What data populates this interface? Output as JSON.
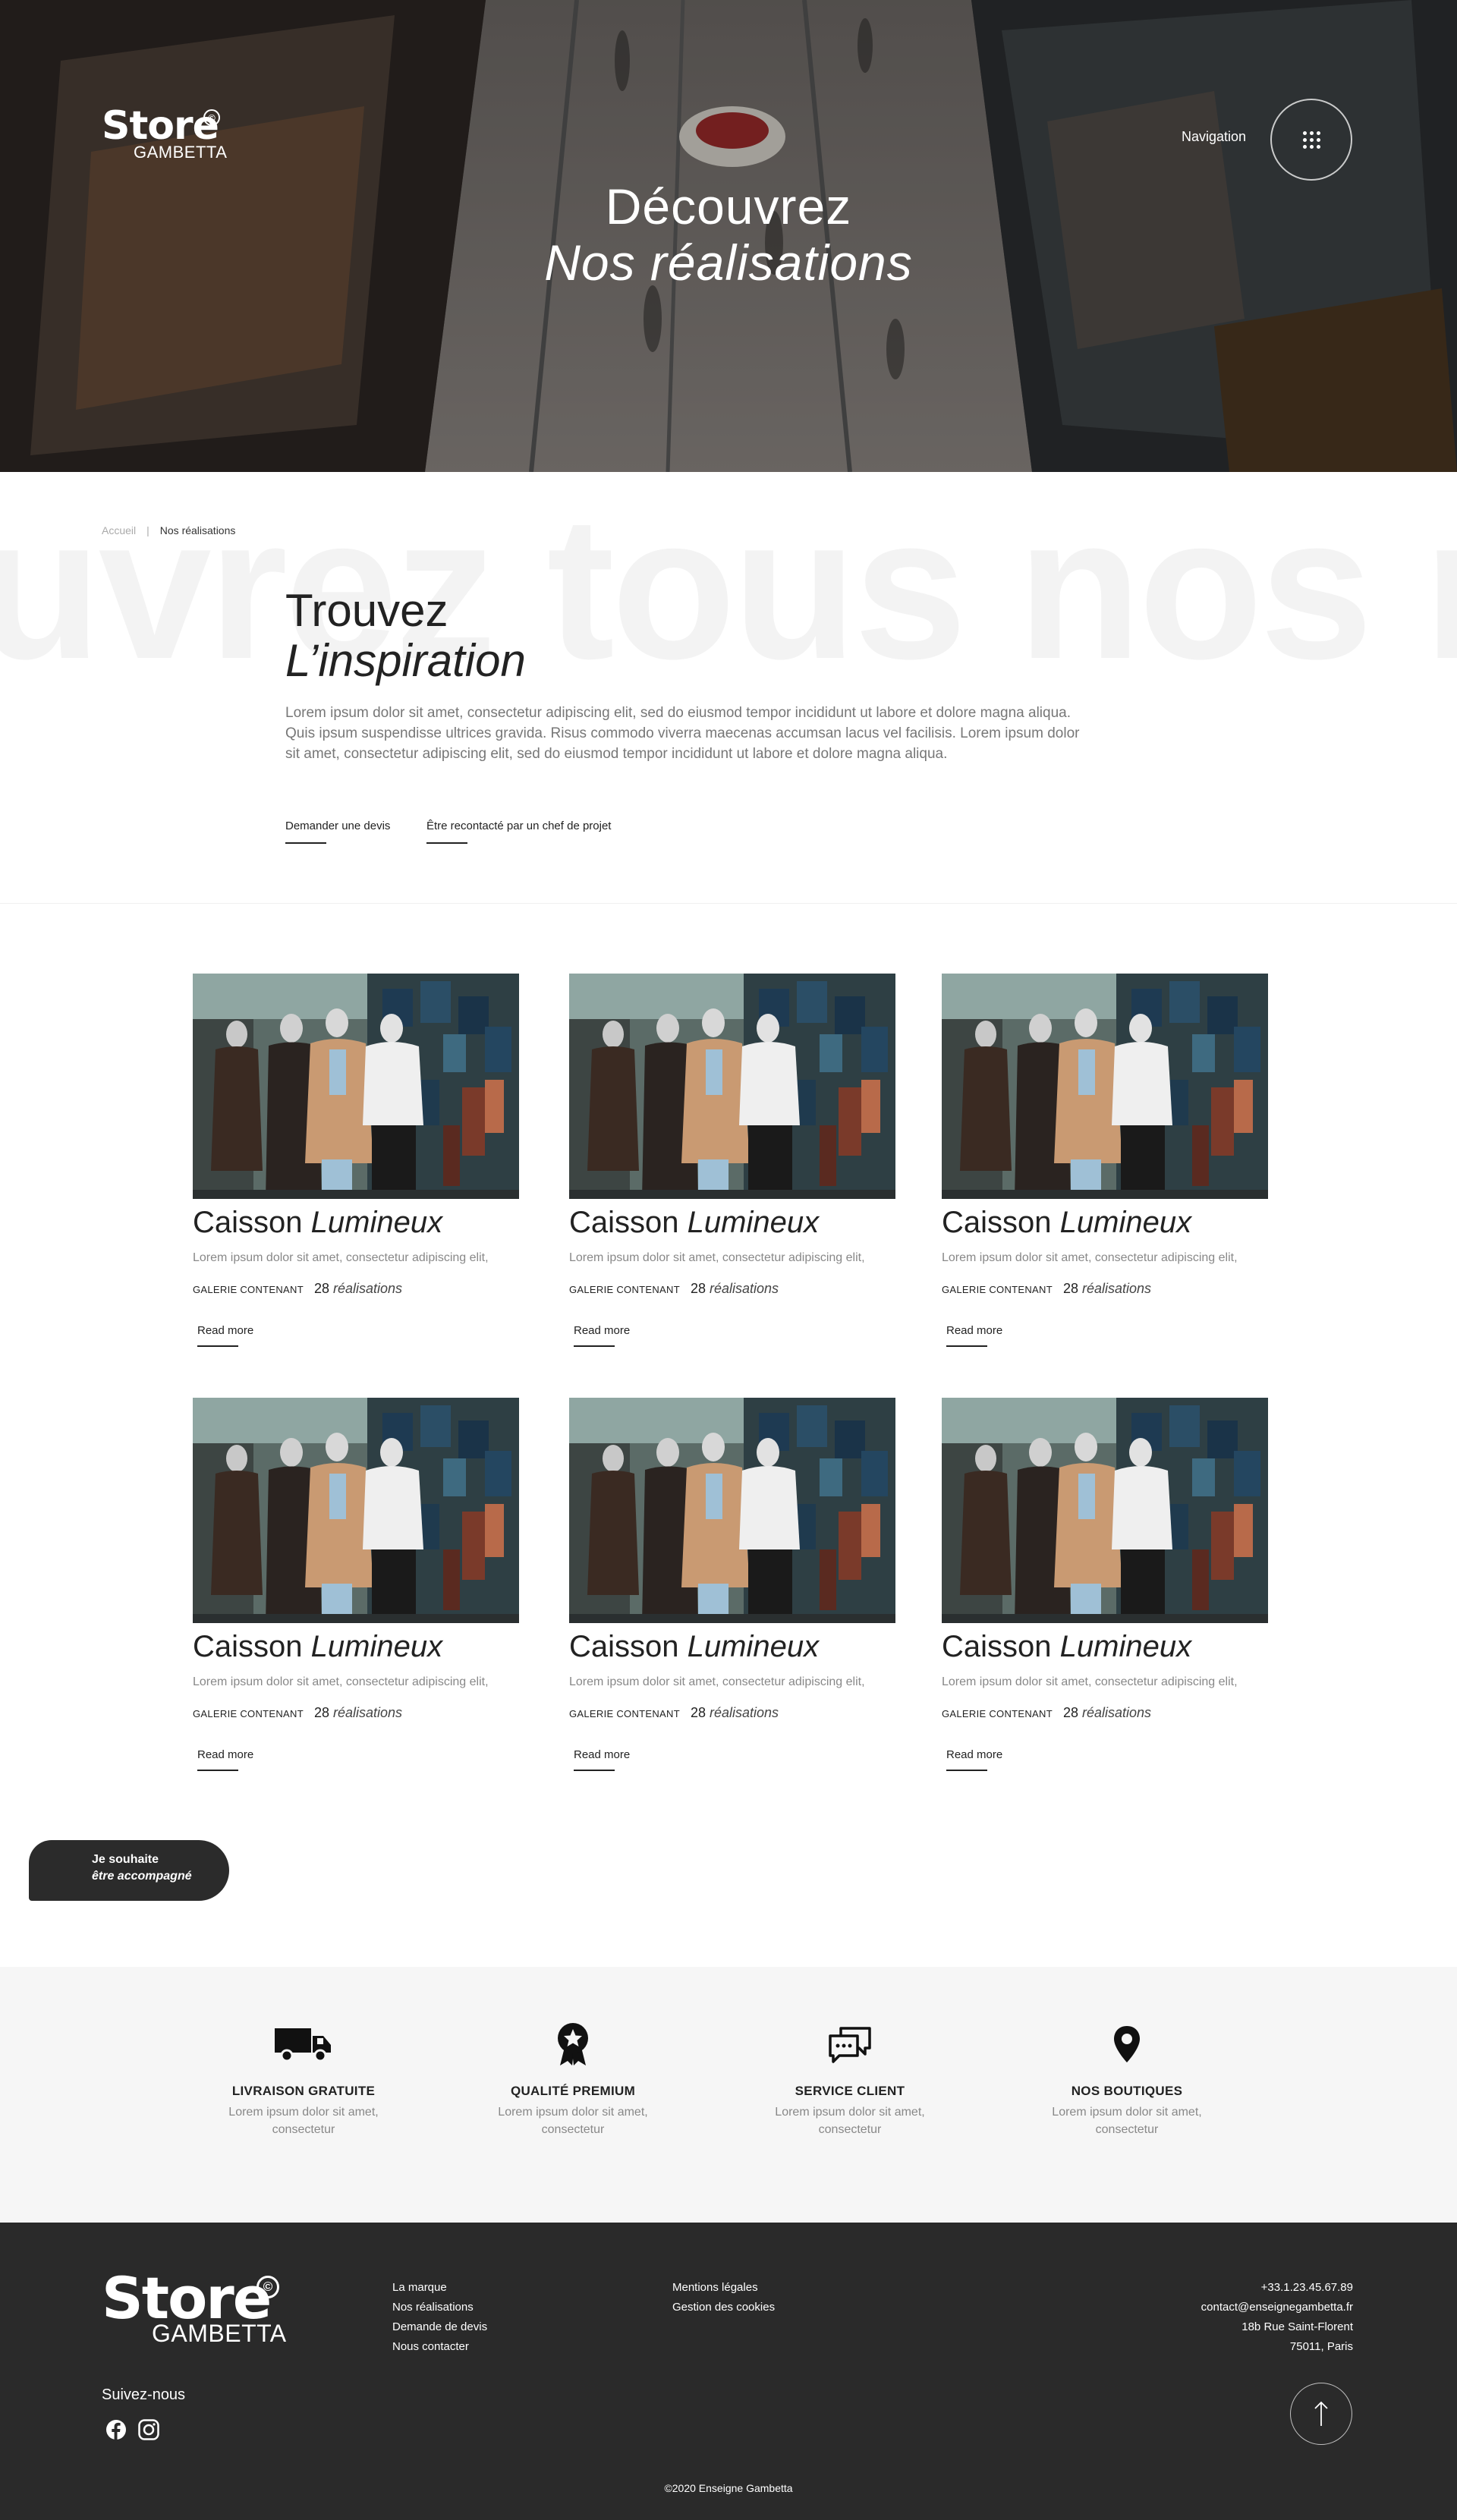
{
  "brand": {
    "name": "Store",
    "sub": "GAMBETTA",
    "copyright_mark": "©"
  },
  "header": {
    "nav_label": "Navigation"
  },
  "hero": {
    "title": "Découvrez",
    "subtitle": "Nos réalisations"
  },
  "breadcrumb": {
    "home": "Accueil",
    "separator": "|",
    "current": "Nos réalisations"
  },
  "intro": {
    "background_text": "uvrez tous nos mé",
    "title": "Trouvez",
    "subtitle": "L’inspiration",
    "paragraph": "Lorem ipsum dolor sit amet, consectetur adipiscing elit, sed do eiusmod tempor incididunt ut labore et dolore magna aliqua. Quis ipsum suspendisse ultrices gravida. Risus commodo viverra maecenas accumsan lacus vel facilisis. Lorem ipsum dolor sit amet, consectetur adipiscing elit, sed do eiusmod tempor incididunt ut labore et dolore magna aliqua.",
    "cta_quote": "Demander une devis",
    "cta_contact": "Être recontacté par un chef de projet"
  },
  "cards": [
    {
      "title": "Caisson",
      "title_italic": "Lumineux",
      "desc": "Lorem ipsum dolor sit amet, consectetur adipiscing elit,",
      "gallery_label": "GALERIE CONTENANT",
      "count": "28",
      "count_label": "réalisations",
      "read_more": "Read more"
    },
    {
      "title": "Caisson",
      "title_italic": "Lumineux",
      "desc": "Lorem ipsum dolor sit amet, consectetur adipiscing elit,",
      "gallery_label": "GALERIE CONTENANT",
      "count": "28",
      "count_label": "réalisations",
      "read_more": "Read more"
    },
    {
      "title": "Caisson",
      "title_italic": "Lumineux",
      "desc": "Lorem ipsum dolor sit amet, consectetur adipiscing elit,",
      "gallery_label": "GALERIE CONTENANT",
      "count": "28",
      "count_label": "réalisations",
      "read_more": "Read more"
    },
    {
      "title": "Caisson",
      "title_italic": "Lumineux",
      "desc": "Lorem ipsum dolor sit amet, consectetur adipiscing elit,",
      "gallery_label": "GALERIE CONTENANT",
      "count": "28",
      "count_label": "réalisations",
      "read_more": "Read more"
    },
    {
      "title": "Caisson",
      "title_italic": "Lumineux",
      "desc": "Lorem ipsum dolor sit amet, consectetur adipiscing elit,",
      "gallery_label": "GALERIE CONTENANT",
      "count": "28",
      "count_label": "réalisations",
      "read_more": "Read more"
    },
    {
      "title": "Caisson",
      "title_italic": "Lumineux",
      "desc": "Lorem ipsum dolor sit amet, consectetur adipiscing elit,",
      "gallery_label": "GALERIE CONTENANT",
      "count": "28",
      "count_label": "réalisations",
      "read_more": "Read more"
    }
  ],
  "chat_bubble": {
    "line1": "Je souhaite",
    "line2": "être accompagné"
  },
  "features": [
    {
      "icon": "truck-icon",
      "title": "LIVRAISON GRATUITE",
      "desc": "Lorem ipsum dolor sit amet, consectetur"
    },
    {
      "icon": "award-icon",
      "title": "QUALITÉ PREMIUM",
      "desc": "Lorem ipsum dolor sit amet, consectetur"
    },
    {
      "icon": "chat-icon",
      "title": "SERVICE CLIENT",
      "desc": "Lorem ipsum dolor sit amet, consectetur"
    },
    {
      "icon": "map-pin-icon",
      "title": "NOS BOUTIQUES",
      "desc": "Lorem ipsum dolor sit amet, consectetur"
    }
  ],
  "footer": {
    "follow": "Suivez-nous",
    "links_col1": [
      "La marque",
      "Nos réalisations",
      "Demande de devis",
      "Nous contacter"
    ],
    "links_col2": [
      "Mentions légales",
      "Gestion des cookies"
    ],
    "contact": {
      "phone": "+33.1.23.45.67.89",
      "email": "contact@enseignegambetta.fr",
      "address1": "18b Rue Saint-Florent",
      "address2": "75011, Paris"
    },
    "copyright": "©2020 Enseigne Gambetta",
    "social": [
      "facebook-icon",
      "instagram-icon"
    ]
  },
  "colors": {
    "dark": "#2a2a2a",
    "light_bg": "#f6f6f6",
    "text": "#222222",
    "muted": "#888888"
  }
}
